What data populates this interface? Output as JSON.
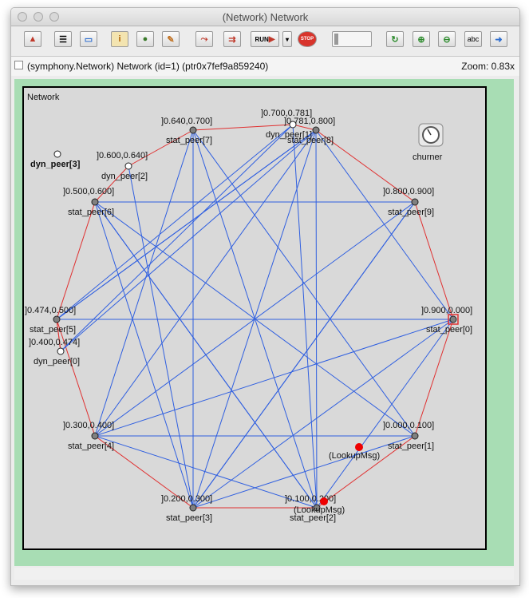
{
  "window": {
    "title": "(Network) Network"
  },
  "toolbar": {
    "buttons": [
      "up-icon",
      "list-icon",
      "screen-icon",
      "info-icon",
      "object-icon",
      "wand-icon",
      "step-icon",
      "fast-run-icon",
      "run-icon",
      "dropdown-icon",
      "stop-icon",
      "slider",
      "refresh-icon",
      "zoom-in-icon",
      "zoom-out-icon",
      "abc-icon",
      "arrow-right-icon"
    ],
    "run_label": "RUN",
    "stop_label": "STOP",
    "abc_label": "abc"
  },
  "infobar": {
    "module_path": "(symphony.Network) Network  (id=1)  (ptr0x7fef9a859240)",
    "zoom": "Zoom: 0.83x"
  },
  "network": {
    "label": "Network",
    "churner_label": "churner",
    "nodes": [
      {
        "name": "stat_peer[0]",
        "range": "]0.900,0.000]"
      },
      {
        "name": "stat_peer[1]",
        "range": "]0.000,0.100]"
      },
      {
        "name": "stat_peer[2]",
        "range": "]0.100,0.200]"
      },
      {
        "name": "stat_peer[3]",
        "range": "]0.200,0.300]"
      },
      {
        "name": "stat_peer[4]",
        "range": "]0.300,0.400]"
      },
      {
        "name": "stat_peer[5]",
        "range": "]0.474,0.500]"
      },
      {
        "name": "stat_peer[6]",
        "range": "]0.500,0.600]"
      },
      {
        "name": "stat_peer[7]",
        "range": "]0.640,0.700]"
      },
      {
        "name": "stat_peer[8]",
        "range": "]0.781,0.800]"
      },
      {
        "name": "stat_peer[9]",
        "range": "]0.800,0.900]"
      },
      {
        "name": "dyn_peer[0]",
        "range": "]0.400,0.474]"
      },
      {
        "name": "dyn_peer[1]",
        "range": "]0.700,0.781]"
      },
      {
        "name": "dyn_peer[2]",
        "range": "]0.600,0.640]"
      },
      {
        "name": "dyn_peer[3]",
        "range": ""
      }
    ],
    "messages": [
      "(LookupMsg)",
      "(LookupMsg)"
    ],
    "colors": {
      "ring": "#e03030",
      "finger": "#2f5fe0",
      "stat_node": "#808080",
      "dyn_node": "#ffffff",
      "msg": "#ee0000",
      "background": "#d9d9d9",
      "canvas": "#a8ddb4"
    }
  }
}
